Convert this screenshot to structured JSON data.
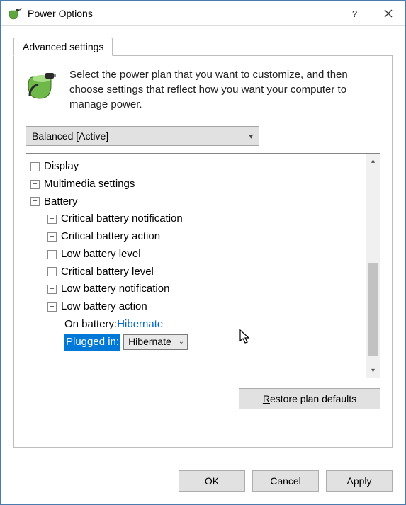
{
  "title": "Power Options",
  "tab": "Advanced settings",
  "intro": "Select the power plan that you want to customize, and then choose settings that reflect how you want your computer to manage power.",
  "plan": "Balanced [Active]",
  "tree": {
    "display": "Display",
    "multimedia": "Multimedia settings",
    "battery": "Battery",
    "critNotif": "Critical battery notification",
    "critAction": "Critical battery action",
    "lowLevel": "Low battery level",
    "critLevel": "Critical battery level",
    "lowNotif": "Low battery notification",
    "lowAction": "Low battery action",
    "onBatteryLabel": "On battery: ",
    "onBatteryValue": "Hibernate",
    "pluggedInLabel": "Plugged in:",
    "pluggedInValue": "Hibernate"
  },
  "buttons": {
    "restore": "Restore plan defaults",
    "ok": "OK",
    "cancel": "Cancel",
    "apply": "Apply"
  }
}
